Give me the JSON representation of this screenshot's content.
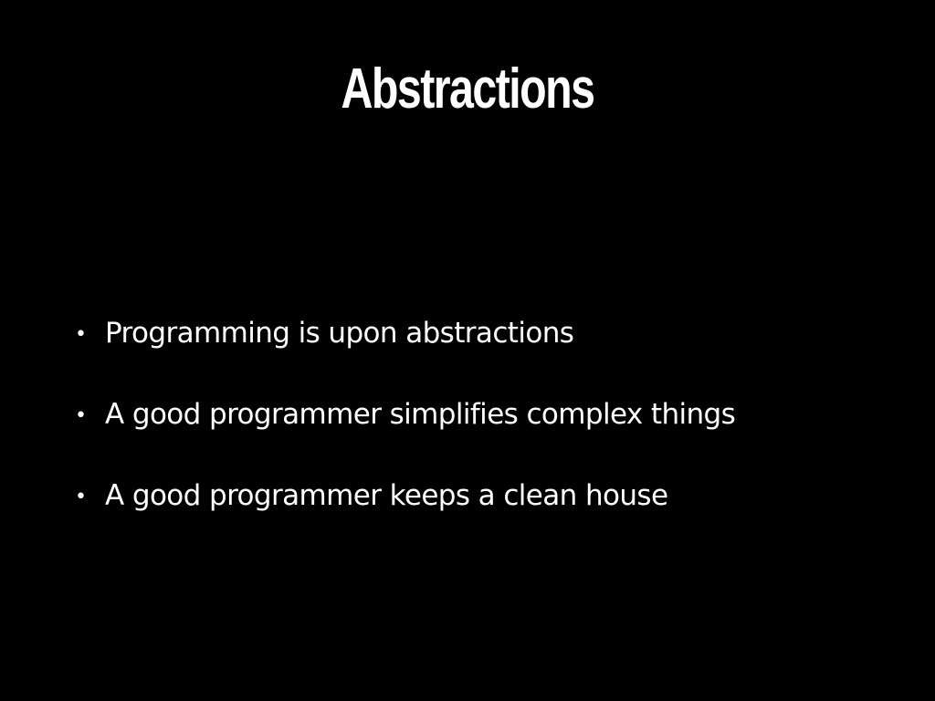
{
  "colors": {
    "background": "#000000",
    "text": "#ffffff"
  },
  "slide": {
    "title": "Abstractions",
    "bullet_symbol": "•",
    "bullets": [
      "Programming is upon abstractions",
      "A good programmer simplifies complex things",
      "A good programmer keeps a clean house"
    ]
  }
}
